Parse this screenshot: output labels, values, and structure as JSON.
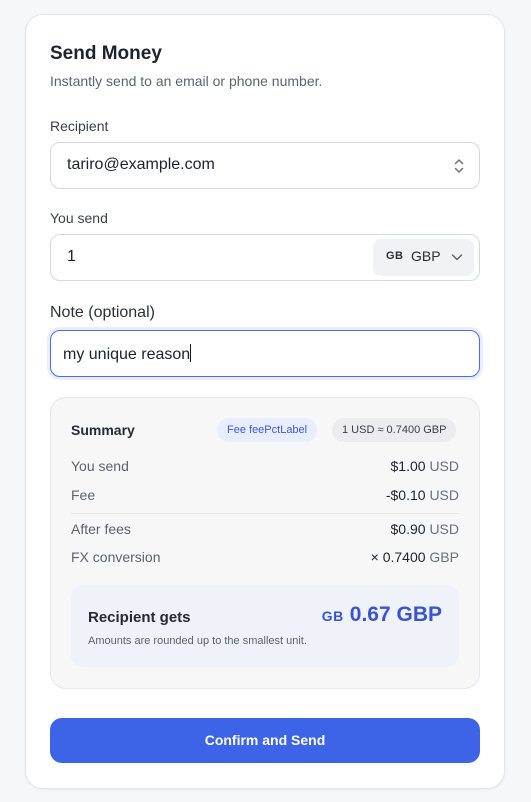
{
  "header": {
    "title": "Send Money",
    "subtitle": "Instantly send to an email or phone number."
  },
  "recipient": {
    "label": "Recipient",
    "value": "tariro@example.com",
    "icon": "updown-chevron-icon"
  },
  "amount": {
    "label": "You send",
    "value": "1",
    "currency_code": "GB",
    "currency": "GBP",
    "icon": "chevron-down-icon"
  },
  "note": {
    "label": "Note (optional)",
    "value": "my unique reason"
  },
  "summary": {
    "title": "Summary",
    "fee_pill": "Fee feePctLabel",
    "rate_pill": "1 USD ≈ 0.7400 GBP",
    "rows": [
      {
        "label": "You send",
        "amount": "$1.00",
        "currency": "USD"
      },
      {
        "label": "Fee",
        "amount": "-$0.10",
        "currency": "USD"
      },
      {
        "label": "After fees",
        "amount": "$0.90",
        "currency": "USD"
      },
      {
        "label": "FX conversion",
        "amount": "× 0.7400",
        "currency": "GBP"
      }
    ],
    "recipient_gets": {
      "label": "Recipient gets",
      "code": "GB",
      "amount": "0.67 GBP",
      "note": "Amounts are rounded up to the smallest unit."
    }
  },
  "actions": {
    "confirm_label": "Confirm and Send"
  },
  "colors": {
    "accent": "#3d63e6",
    "focus_border": "#4a6cf0",
    "gets_amount": "#3853d6"
  }
}
